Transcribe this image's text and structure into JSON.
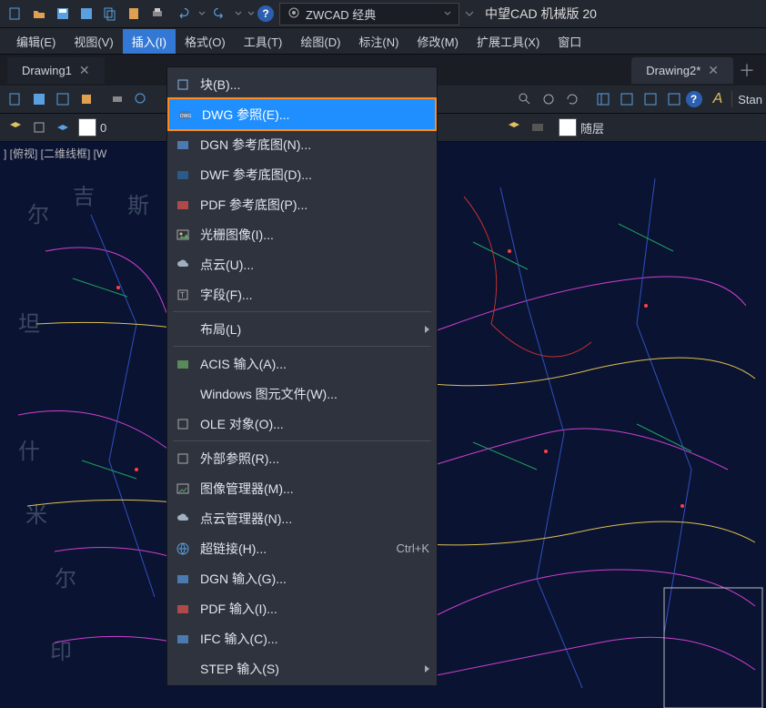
{
  "top": {
    "workspace_label": "ZWCAD 经典",
    "app_title": "中望CAD 机械版 20"
  },
  "menubar": [
    "编辑(E)",
    "视图(V)",
    "插入(I)",
    "格式(O)",
    "工具(T)",
    "绘图(D)",
    "标注(N)",
    "修改(M)",
    "扩展工具(X)",
    "窗口"
  ],
  "menubar_active_index": 2,
  "tabs": {
    "left": "Drawing1",
    "right": "Drawing2*"
  },
  "thirdbar": {
    "layer_label": "随层",
    "zero_label": "0",
    "style_label": "Stan"
  },
  "status_text": "] [俯视] [二维线框] [W",
  "bg_labels": [
    "尔",
    "吉",
    "斯",
    "坦",
    "什",
    "米",
    "尔",
    "印"
  ],
  "dropdown": [
    {
      "label": "块(B)...",
      "icon": "block"
    },
    {
      "label": "DWG 参照(E)...",
      "icon": "dwg",
      "highlight": true
    },
    {
      "label": "DGN 参考底图(N)...",
      "icon": "dgn"
    },
    {
      "label": "DWF 参考底图(D)...",
      "icon": "dwf"
    },
    {
      "label": "PDF 参考底图(P)...",
      "icon": "pdf"
    },
    {
      "label": "光栅图像(I)...",
      "icon": "image"
    },
    {
      "label": "点云(U)...",
      "icon": "cloud"
    },
    {
      "label": "字段(F)...",
      "icon": "field"
    },
    {
      "sep": true
    },
    {
      "label": "布局(L)",
      "submenu": true
    },
    {
      "sep": true
    },
    {
      "label": "ACIS 输入(A)...",
      "icon": "acis"
    },
    {
      "label": "Windows 图元文件(W)..."
    },
    {
      "label": "OLE 对象(O)...",
      "icon": "ole"
    },
    {
      "sep": true
    },
    {
      "label": "外部参照(R)...",
      "icon": "xref"
    },
    {
      "label": "图像管理器(M)...",
      "icon": "imgmgr"
    },
    {
      "label": "点云管理器(N)...",
      "icon": "cloudmgr"
    },
    {
      "label": "超链接(H)...",
      "icon": "link",
      "shortcut": "Ctrl+K"
    },
    {
      "label": "DGN 输入(G)...",
      "icon": "dgn2"
    },
    {
      "label": "PDF 输入(I)...",
      "icon": "pdf2"
    },
    {
      "label": "IFC 输入(C)...",
      "icon": "ifc"
    },
    {
      "label": "STEP 输入(S)",
      "submenu": true
    }
  ]
}
